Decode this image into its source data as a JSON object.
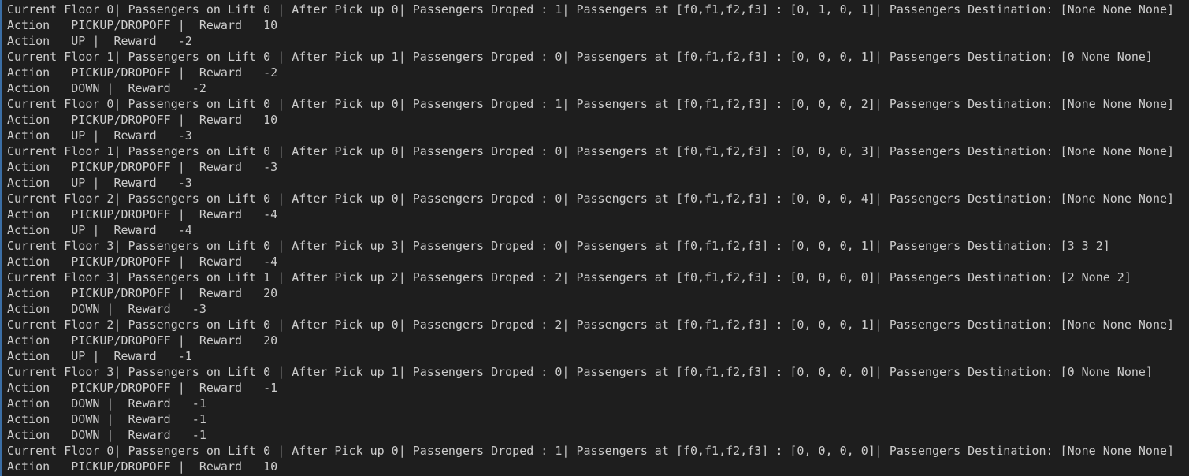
{
  "terminal": {
    "lines": [
      "Current Floor 0| Passengers on Lift 0 | After Pick up 0| Passengers Droped : 1| Passengers at [f0,f1,f2,f3] : [0, 1, 0, 1]| Passengers Destination: [None None None]",
      "Action   PICKUP/DROPOFF |  Reward   10",
      "Action   UP |  Reward   -2",
      "Current Floor 1| Passengers on Lift 0 | After Pick up 1| Passengers Droped : 0| Passengers at [f0,f1,f2,f3] : [0, 0, 0, 1]| Passengers Destination: [0 None None]",
      "Action   PICKUP/DROPOFF |  Reward   -2",
      "Action   DOWN |  Reward   -2",
      "Current Floor 0| Passengers on Lift 0 | After Pick up 0| Passengers Droped : 1| Passengers at [f0,f1,f2,f3] : [0, 0, 0, 2]| Passengers Destination: [None None None]",
      "Action   PICKUP/DROPOFF |  Reward   10",
      "Action   UP |  Reward   -3",
      "Current Floor 1| Passengers on Lift 0 | After Pick up 0| Passengers Droped : 0| Passengers at [f0,f1,f2,f3] : [0, 0, 0, 3]| Passengers Destination: [None None None]",
      "Action   PICKUP/DROPOFF |  Reward   -3",
      "Action   UP |  Reward   -3",
      "Current Floor 2| Passengers on Lift 0 | After Pick up 0| Passengers Droped : 0| Passengers at [f0,f1,f2,f3] : [0, 0, 0, 4]| Passengers Destination: [None None None]",
      "Action   PICKUP/DROPOFF |  Reward   -4",
      "Action   UP |  Reward   -4",
      "Current Floor 3| Passengers on Lift 0 | After Pick up 3| Passengers Droped : 0| Passengers at [f0,f1,f2,f3] : [0, 0, 0, 1]| Passengers Destination: [3 3 2]",
      "Action   PICKUP/DROPOFF |  Reward   -4",
      "Current Floor 3| Passengers on Lift 1 | After Pick up 2| Passengers Droped : 2| Passengers at [f0,f1,f2,f3] : [0, 0, 0, 0]| Passengers Destination: [2 None 2]",
      "Action   PICKUP/DROPOFF |  Reward   20",
      "Action   DOWN |  Reward   -3",
      "Current Floor 2| Passengers on Lift 0 | After Pick up 0| Passengers Droped : 2| Passengers at [f0,f1,f2,f3] : [0, 0, 0, 1]| Passengers Destination: [None None None]",
      "Action   PICKUP/DROPOFF |  Reward   20",
      "Action   UP |  Reward   -1",
      "Current Floor 3| Passengers on Lift 0 | After Pick up 1| Passengers Droped : 0| Passengers at [f0,f1,f2,f3] : [0, 0, 0, 0]| Passengers Destination: [0 None None]",
      "Action   PICKUP/DROPOFF |  Reward   -1",
      "Action   DOWN |  Reward   -1",
      "Action   DOWN |  Reward   -1",
      "Action   DOWN |  Reward   -1",
      "Current Floor 0| Passengers on Lift 0 | After Pick up 0| Passengers Droped : 1| Passengers at [f0,f1,f2,f3] : [0, 0, 0, 0]| Passengers Destination: [None None None]",
      "Action   PICKUP/DROPOFF |  Reward   10"
    ]
  },
  "colors": {
    "background": "#1e1e1e",
    "text": "#cccccc",
    "accent": "#3b6ea5"
  }
}
